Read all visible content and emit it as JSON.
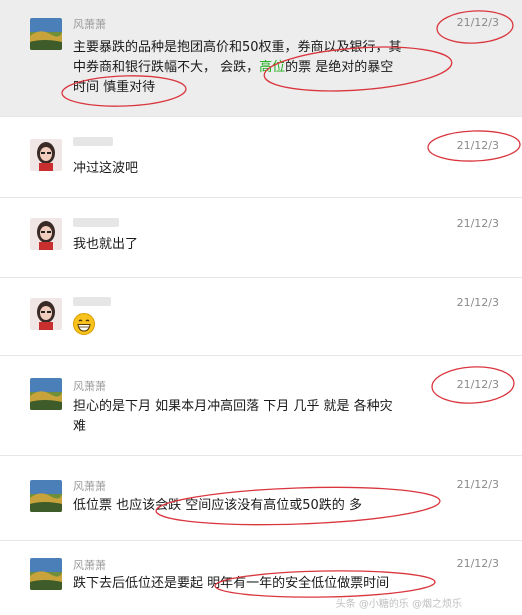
{
  "messages": [
    {
      "sender": "风萧萧",
      "time": "21/12/3",
      "text_line1": "主要暴跌的品种是抱团高价和50权重，券商以及银行，其",
      "text_line2_a": "中券商和银行跌幅不大， 会跌，",
      "text_line2_green": "高位",
      "text_line2_b": "的票 是绝对的暴空",
      "text_line3": "时间  慎重对待"
    },
    {
      "sender": "",
      "time": "21/12/3",
      "text": "冲过这波吧"
    },
    {
      "sender": "",
      "time": "21/12/3",
      "text": "我也就出了"
    },
    {
      "sender": "",
      "time": "21/12/3",
      "emoji": "grinning-face"
    },
    {
      "sender": "风萧萧",
      "time": "21/12/3",
      "text_line1": "担心的是下月  如果本月冲高回落 下月  几乎 就是  各种灾",
      "text_line2": "难"
    },
    {
      "sender": "风萧萧",
      "time": "21/12/3",
      "text": "低位票 也应该会跌 空间应该没有高位或50跌的 多"
    },
    {
      "sender": "风萧萧",
      "time": "21/12/3",
      "text": "跌下去后低位还是要起  明年有一年的安全低位做票时间"
    }
  ],
  "watermark": "头条 @小糖的乐 @烟之烦乐",
  "colors": {
    "highlight_bg": "#ededed",
    "green_text": "#1aad19",
    "annotation_red": "#d9363e"
  }
}
